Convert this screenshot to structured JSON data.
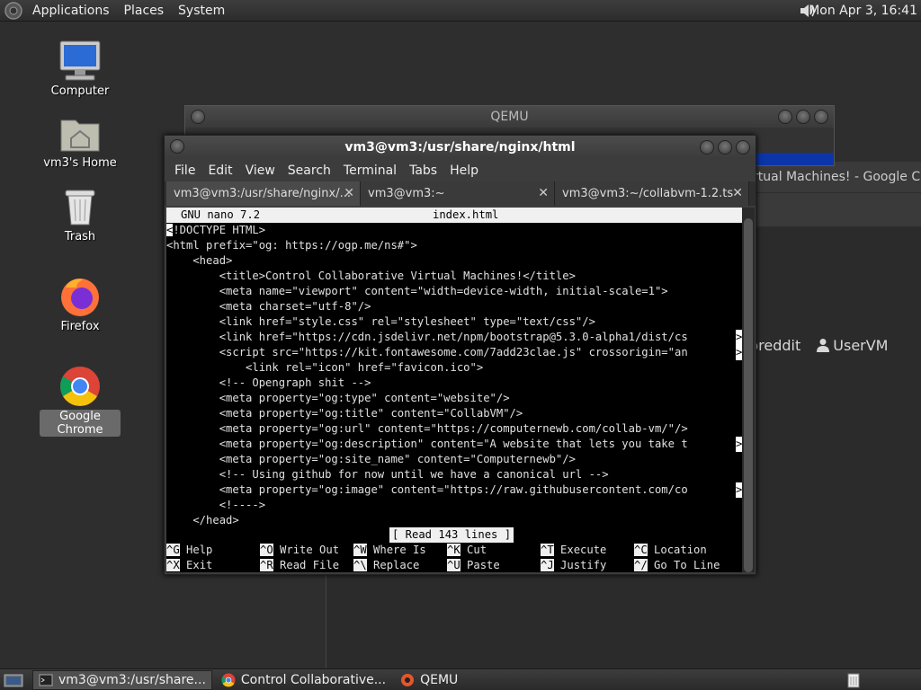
{
  "top_panel": {
    "menus": [
      "Applications",
      "Places",
      "System"
    ],
    "clock": "Mon Apr  3, 16:41"
  },
  "desktop_icons": [
    {
      "label": "Computer",
      "icon": "computer-icon"
    },
    {
      "label": "vm3's Home",
      "icon": "home-folder-icon"
    },
    {
      "label": "Trash",
      "icon": "trash-icon"
    },
    {
      "label": "Firefox",
      "icon": "firefox-icon"
    },
    {
      "label": "Google Chrome",
      "icon": "chrome-icon",
      "selected": true
    }
  ],
  "qemu_window": {
    "title": "QEMU"
  },
  "background_browser": {
    "title": "Control Collaborative Virtual Machines! - Google Chrome",
    "visible_title": "rtual Machines! - Google Chro",
    "links": [
      "breddit",
      "UserVM"
    ]
  },
  "terminal": {
    "title": "vm3@vm3:/usr/share/nginx/html",
    "menus": [
      "File",
      "Edit",
      "View",
      "Search",
      "Terminal",
      "Tabs",
      "Help"
    ],
    "tabs": [
      {
        "label": "vm3@vm3:/usr/share/nginx/...",
        "active": true
      },
      {
        "label": "vm3@vm3:~",
        "active": false
      },
      {
        "label": "vm3@vm3:~/collabvm-1.2.ts",
        "active": false
      }
    ],
    "nano": {
      "version": "GNU nano 7.2",
      "filename": "index.html",
      "lines": [
        "!DOCTYPE HTML>",
        "<html prefix=\"og: https://ogp.me/ns#\">",
        "    <head>",
        "        <title>Control Collaborative Virtual Machines!</title>",
        "        <meta name=\"viewport\" content=\"width=device-width, initial-scale=1\">",
        "        <meta charset=\"utf-8\"/>",
        "        <link href=\"style.css\" rel=\"stylesheet\" type=\"text/css\"/>",
        "        <link href=\"https://cdn.jsdelivr.net/npm/bootstrap@5.3.0-alpha1/dist/cs",
        "        <script src=\"https://kit.fontawesome.com/7add23clae.js\" crossorigin=\"an",
        "            <link rel=\"icon\" href=\"favicon.ico\">",
        "        <!-- Opengraph shit -->",
        "        <meta property=\"og:type\" content=\"website\"/>",
        "        <meta property=\"og:title\" content=\"CollabVM\"/>",
        "        <meta property=\"og:url\" content=\"https://computernewb.com/collab-vm/\"/>",
        "        <meta property=\"og:description\" content=\"A website that lets you take t",
        "        <meta property=\"og:site_name\" content=\"Computernewb\"/>",
        "        <!-- Using github for now until we have a canonical url -->",
        "        <meta property=\"og:image\" content=\"https://raw.githubusercontent.com/co",
        "        <!---->",
        "    </head>"
      ],
      "first_char": "<",
      "truncated_lines": [
        7,
        8,
        14,
        17
      ],
      "status": "[ Read 143 lines ]",
      "shortcuts_row1": [
        {
          "key": "^G",
          "label": "Help"
        },
        {
          "key": "^O",
          "label": "Write Out"
        },
        {
          "key": "^W",
          "label": "Where Is"
        },
        {
          "key": "^K",
          "label": "Cut"
        },
        {
          "key": "^T",
          "label": "Execute"
        },
        {
          "key": "^C",
          "label": "Location"
        }
      ],
      "shortcuts_row2": [
        {
          "key": "^X",
          "label": "Exit"
        },
        {
          "key": "^R",
          "label": "Read File"
        },
        {
          "key": "^\\",
          "label": "Replace"
        },
        {
          "key": "^U",
          "label": "Paste"
        },
        {
          "key": "^J",
          "label": "Justify"
        },
        {
          "key": "^/",
          "label": "Go To Line"
        }
      ]
    }
  },
  "taskbar": {
    "tasks": [
      {
        "label": "vm3@vm3:/usr/share...",
        "icon": "terminal-icon",
        "active": true
      },
      {
        "label": "Control Collaborative...",
        "icon": "chrome-icon",
        "active": false
      },
      {
        "label": "QEMU",
        "icon": "qemu-icon",
        "active": false
      }
    ]
  },
  "colors": {
    "desktop": "#2e2e2e",
    "qemu_blue": "#0b35a8",
    "terminal_bg": "#000000"
  }
}
